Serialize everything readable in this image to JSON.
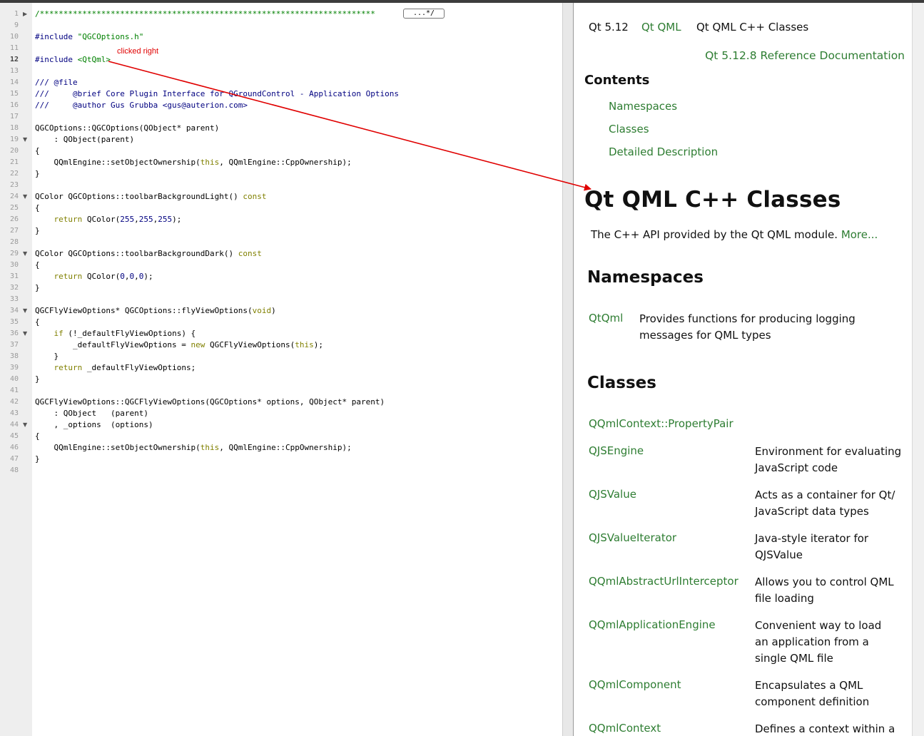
{
  "editor": {
    "lines": [
      {
        "num": "1",
        "fold": true,
        "tokens": [
          {
            "t": "/***********************************************************************",
            "c": "s"
          }
        ]
      },
      {
        "num": "9",
        "tokens": []
      },
      {
        "num": "10",
        "tokens": [
          {
            "t": "#include ",
            "c": "n"
          },
          {
            "t": "\"QGCOptions.h\"",
            "c": "s"
          }
        ]
      },
      {
        "num": "11",
        "tokens": []
      },
      {
        "num": "12",
        "current": true,
        "tokens": [
          {
            "t": "#include ",
            "c": "n"
          },
          {
            "t": "<QtQml>",
            "c": "s"
          }
        ]
      },
      {
        "num": "13",
        "tokens": []
      },
      {
        "num": "14",
        "tokens": [
          {
            "t": "/// @file",
            "c": "c"
          }
        ]
      },
      {
        "num": "15",
        "tokens": [
          {
            "t": "///     @brief Core Plugin Interface for QGroundControl - Application Options",
            "c": "c"
          }
        ]
      },
      {
        "num": "16",
        "tokens": [
          {
            "t": "///     @author Gus Grubba <gus@auterion.com>",
            "c": "c"
          }
        ]
      },
      {
        "num": "17",
        "tokens": []
      },
      {
        "num": "18",
        "tokens": [
          {
            "t": "QGCOptions::QGCOptions(QObject* parent)"
          }
        ]
      },
      {
        "num": "19",
        "fold": true,
        "tokens": [
          {
            "t": "    : QObject(parent)"
          }
        ]
      },
      {
        "num": "20",
        "tokens": [
          {
            "t": "{"
          }
        ]
      },
      {
        "num": "21",
        "tokens": [
          {
            "t": "    QQmlEngine::setObjectOwnership("
          },
          {
            "t": "this",
            "c": "k"
          },
          {
            "t": ", QQmlEngine::CppOwnership);"
          }
        ]
      },
      {
        "num": "22",
        "tokens": [
          {
            "t": "}"
          }
        ]
      },
      {
        "num": "23",
        "tokens": []
      },
      {
        "num": "24",
        "fold": true,
        "tokens": [
          {
            "t": "QColor QGCOptions::toolbarBackgroundLight() "
          },
          {
            "t": "const",
            "c": "k"
          }
        ]
      },
      {
        "num": "25",
        "tokens": [
          {
            "t": "{"
          }
        ]
      },
      {
        "num": "26",
        "tokens": [
          {
            "t": "    "
          },
          {
            "t": "return",
            "c": "k"
          },
          {
            "t": " QColor("
          },
          {
            "t": "255",
            "c": "n"
          },
          {
            "t": ","
          },
          {
            "t": "255",
            "c": "n"
          },
          {
            "t": ","
          },
          {
            "t": "255",
            "c": "n"
          },
          {
            "t": ");"
          }
        ]
      },
      {
        "num": "27",
        "tokens": [
          {
            "t": "}"
          }
        ]
      },
      {
        "num": "28",
        "tokens": []
      },
      {
        "num": "29",
        "fold": true,
        "tokens": [
          {
            "t": "QColor QGCOptions::toolbarBackgroundDark() "
          },
          {
            "t": "const",
            "c": "k"
          }
        ]
      },
      {
        "num": "30",
        "tokens": [
          {
            "t": "{"
          }
        ]
      },
      {
        "num": "31",
        "tokens": [
          {
            "t": "    "
          },
          {
            "t": "return",
            "c": "k"
          },
          {
            "t": " QColor("
          },
          {
            "t": "0",
            "c": "n"
          },
          {
            "t": ","
          },
          {
            "t": "0",
            "c": "n"
          },
          {
            "t": ","
          },
          {
            "t": "0",
            "c": "n"
          },
          {
            "t": ");"
          }
        ]
      },
      {
        "num": "32",
        "tokens": [
          {
            "t": "}"
          }
        ]
      },
      {
        "num": "33",
        "tokens": []
      },
      {
        "num": "34",
        "fold": true,
        "tokens": [
          {
            "t": "QGCFlyViewOptions* QGCOptions::flyViewOptions("
          },
          {
            "t": "void",
            "c": "k"
          },
          {
            "t": ")"
          }
        ]
      },
      {
        "num": "35",
        "tokens": [
          {
            "t": "{"
          }
        ]
      },
      {
        "num": "36",
        "fold": true,
        "tokens": [
          {
            "t": "    "
          },
          {
            "t": "if",
            "c": "k"
          },
          {
            "t": " (!_defaultFlyViewOptions) {"
          }
        ]
      },
      {
        "num": "37",
        "tokens": [
          {
            "t": "        _defaultFlyViewOptions = "
          },
          {
            "t": "new",
            "c": "k"
          },
          {
            "t": " QGCFlyViewOptions("
          },
          {
            "t": "this",
            "c": "k"
          },
          {
            "t": ");"
          }
        ]
      },
      {
        "num": "38",
        "tokens": [
          {
            "t": "    }"
          }
        ]
      },
      {
        "num": "39",
        "tokens": [
          {
            "t": "    "
          },
          {
            "t": "return",
            "c": "k"
          },
          {
            "t": " _defaultFlyViewOptions;"
          }
        ]
      },
      {
        "num": "40",
        "tokens": [
          {
            "t": "}"
          }
        ]
      },
      {
        "num": "41",
        "tokens": []
      },
      {
        "num": "42",
        "tokens": [
          {
            "t": "QGCFlyViewOptions::QGCFlyViewOptions(QGCOptions* options, QObject* parent)"
          }
        ]
      },
      {
        "num": "43",
        "tokens": [
          {
            "t": "    : QObject   (parent)"
          }
        ]
      },
      {
        "num": "44",
        "fold": true,
        "tokens": [
          {
            "t": "    , _options  (options)"
          }
        ]
      },
      {
        "num": "45",
        "tokens": [
          {
            "t": "{"
          }
        ]
      },
      {
        "num": "46",
        "tokens": [
          {
            "t": "    QQmlEngine::setObjectOwnership("
          },
          {
            "t": "this",
            "c": "k"
          },
          {
            "t": ", QQmlEngine::CppOwnership);"
          }
        ]
      },
      {
        "num": "47",
        "tokens": [
          {
            "t": "}"
          }
        ]
      },
      {
        "num": "48",
        "tokens": []
      }
    ],
    "fold_marker": "...*/",
    "annotation": "clicked right"
  },
  "help": {
    "breadcrumb": {
      "version": "Qt 5.12",
      "module": "Qt QML",
      "page": "Qt QML C++ Classes"
    },
    "doc_link": "Qt 5.12.8 Reference Documentation",
    "contents_title": "Contents",
    "contents": [
      "Namespaces",
      "Classes",
      "Detailed Description"
    ],
    "title": "Qt QML C++ Classes",
    "intro": "The C++ API provided by the Qt QML module.",
    "more_link": "More...",
    "namespaces_title": "Namespaces",
    "namespace": {
      "name": "QtQml",
      "desc": "Provides functions for producing logging messages for QML types"
    },
    "classes_title": "Classes",
    "classes": [
      {
        "name": "QQmlContext::PropertyPair",
        "desc": ""
      },
      {
        "name": "QJSEngine",
        "desc": "Environment for evaluating JavaScript code"
      },
      {
        "name": "QJSValue",
        "desc": "Acts as a container for Qt/ JavaScript data types"
      },
      {
        "name": "QJSValueIterator",
        "desc": "Java-style iterator for QJSValue"
      },
      {
        "name": "QQmlAbstractUrlInterceptor",
        "desc": "Allows you to control QML file loading"
      },
      {
        "name": "QQmlApplicationEngine",
        "desc": "Convenient way to load an application from a single QML file"
      },
      {
        "name": "QQmlComponent",
        "desc": "Encapsulates a QML component definition"
      },
      {
        "name": "QQmlContext",
        "desc": "Defines a context within a"
      }
    ]
  },
  "colors": {
    "link": "#2e7d32",
    "arrow": "#e00000",
    "keyword": "#808000",
    "string": "#008000",
    "number": "#000080"
  }
}
